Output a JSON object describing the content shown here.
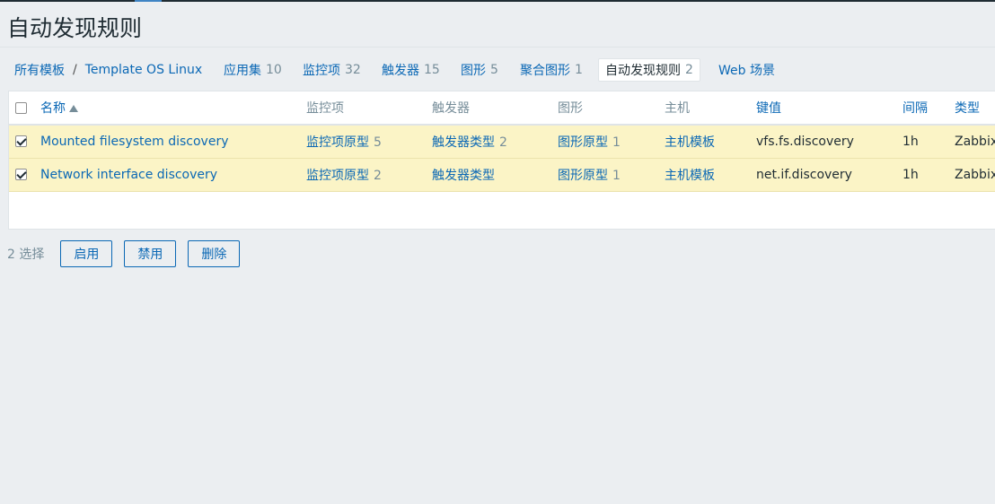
{
  "page": {
    "title": "自动发现规则"
  },
  "breadcrumb": {
    "root": "所有模板",
    "separator": "/",
    "current": "Template OS Linux"
  },
  "tabs": [
    {
      "label": "应用集",
      "count": "10"
    },
    {
      "label": "监控项",
      "count": "32"
    },
    {
      "label": "触发器",
      "count": "15"
    },
    {
      "label": "图形",
      "count": "5"
    },
    {
      "label": "聚合图形",
      "count": "1"
    },
    {
      "label": "自动发现规则",
      "count": "2",
      "active": true
    },
    {
      "label": "Web 场景",
      "count": ""
    }
  ],
  "table": {
    "headers": {
      "name": "名称",
      "items": "监控项",
      "triggers": "触发器",
      "graphs": "图形",
      "hosts": "主机",
      "key": "键值",
      "interval": "间隔",
      "type": "类型"
    },
    "sort": {
      "column": "name",
      "direction": "asc"
    },
    "rows": [
      {
        "checked": true,
        "name": "Mounted filesystem discovery",
        "items_label": "监控项原型",
        "items_count": "5",
        "triggers_label": "触发器类型",
        "triggers_count": "2",
        "graphs_label": "图形原型",
        "graphs_count": "1",
        "hosts_label": "主机模板",
        "key": "vfs.fs.discovery",
        "interval": "1h",
        "type": "Zabbix"
      },
      {
        "checked": true,
        "name": "Network interface discovery",
        "items_label": "监控项原型",
        "items_count": "2",
        "triggers_label": "触发器类型",
        "triggers_count": "",
        "graphs_label": "图形原型",
        "graphs_count": "1",
        "hosts_label": "主机模板",
        "key": "net.if.discovery",
        "interval": "1h",
        "type": "Zabbix"
      }
    ]
  },
  "footer": {
    "selected": "2 选择",
    "buttons": {
      "enable": "启用",
      "disable": "禁用",
      "delete": "删除"
    }
  },
  "colors": {
    "link": "#0b68b5",
    "text": "#1f2c33",
    "muted": "#768d99",
    "selected_row": "#fbf4c6",
    "background": "#ebeef1"
  }
}
